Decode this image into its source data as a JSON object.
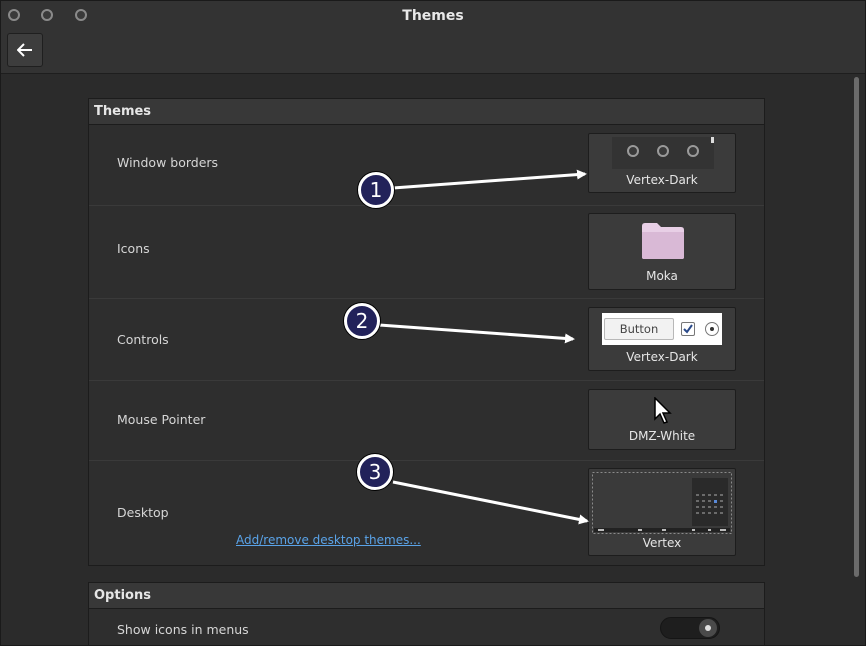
{
  "window": {
    "title": "Themes"
  },
  "sections": {
    "themes": {
      "header": "Themes",
      "rows": {
        "window_borders": {
          "label": "Window borders",
          "value": "Vertex-Dark"
        },
        "icons": {
          "label": "Icons",
          "value": "Moka"
        },
        "controls": {
          "label": "Controls",
          "value": "Vertex-Dark",
          "preview_button": "Button"
        },
        "mouse_pointer": {
          "label": "Mouse Pointer",
          "value": "DMZ-White"
        },
        "desktop": {
          "label": "Desktop",
          "value": "Vertex",
          "link": "Add/remove desktop themes..."
        }
      }
    },
    "options": {
      "header": "Options",
      "show_icons_in_menus": {
        "label": "Show icons in menus",
        "enabled": true
      }
    }
  },
  "annotations": {
    "one": "1",
    "two": "2",
    "three": "3"
  },
  "colors": {
    "accent_link": "#5aa3e8",
    "badge_fill": "#22225a"
  },
  "icons": {
    "back": "back-arrow-icon",
    "folder": "folder-icon",
    "cursor": "cursor-icon"
  }
}
